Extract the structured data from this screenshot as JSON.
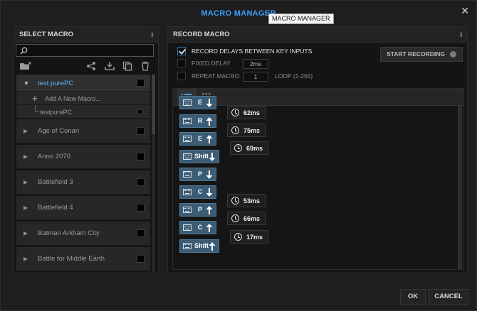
{
  "window": {
    "title": "MACRO MANAGER",
    "tooltip": "MACRO MANAGER",
    "close_glyph": "✕"
  },
  "left_panel": {
    "header": "SELECT MACRO",
    "info_glyph": "i",
    "search_placeholder": "",
    "toolbar_icons": [
      "new-folder-icon",
      "share-icon",
      "export-icon",
      "copy-icon",
      "delete-icon"
    ],
    "groups": [
      {
        "label": "test purePC",
        "expanded": true,
        "selected": true
      },
      {
        "label": "Age of Conan"
      },
      {
        "label": "Anno 2070"
      },
      {
        "label": "Battlefield 3"
      },
      {
        "label": "Battlefield 4"
      },
      {
        "label": "Batman Arkham City"
      },
      {
        "label": "Battle for Middle Earth"
      }
    ],
    "add_macro_label": "Add A New Macro...",
    "child_macro_label": "testpurePC"
  },
  "right_panel": {
    "header": "RECORD MACRO",
    "info_glyph": "i",
    "options": {
      "record_delays": {
        "label": "RECORD DELAYS BETWEEN KEY INPUTS",
        "checked": true
      },
      "fixed_delay": {
        "label": "FIXED DELAY",
        "checked": false,
        "value": "2ms"
      },
      "repeat_macro": {
        "label": "REPEAT MACRO",
        "checked": false,
        "value": "1",
        "suffix": "LOOP (1-255)"
      }
    },
    "start_recording_label": "START RECORDING",
    "view_tabs": [
      "list-view-icon",
      "grid-view-icon"
    ],
    "sequence": [
      {
        "type": "key",
        "key": "E",
        "direction": "down"
      },
      {
        "type": "delay",
        "value": "62ms"
      },
      {
        "type": "key",
        "key": "R",
        "direction": "up"
      },
      {
        "type": "delay",
        "value": "75ms"
      },
      {
        "type": "key",
        "key": "E",
        "direction": "up"
      },
      {
        "type": "delay",
        "value": "69ms"
      },
      {
        "type": "key",
        "key": "Shift",
        "direction": "down"
      },
      {
        "type": "key",
        "key": "P",
        "direction": "down"
      },
      {
        "type": "key",
        "key": "C",
        "direction": "down"
      },
      {
        "type": "delay",
        "value": "53ms"
      },
      {
        "type": "key",
        "key": "P",
        "direction": "up"
      },
      {
        "type": "delay",
        "value": "66ms"
      },
      {
        "type": "key",
        "key": "C",
        "direction": "up"
      },
      {
        "type": "delay",
        "value": "17ms"
      },
      {
        "type": "key",
        "key": "Shift",
        "direction": "up"
      }
    ]
  },
  "footer": {
    "ok_label": "OK",
    "cancel_label": "CANCEL"
  },
  "colors": {
    "accent": "#3aa0ff",
    "key_block": "#3b5c74"
  }
}
